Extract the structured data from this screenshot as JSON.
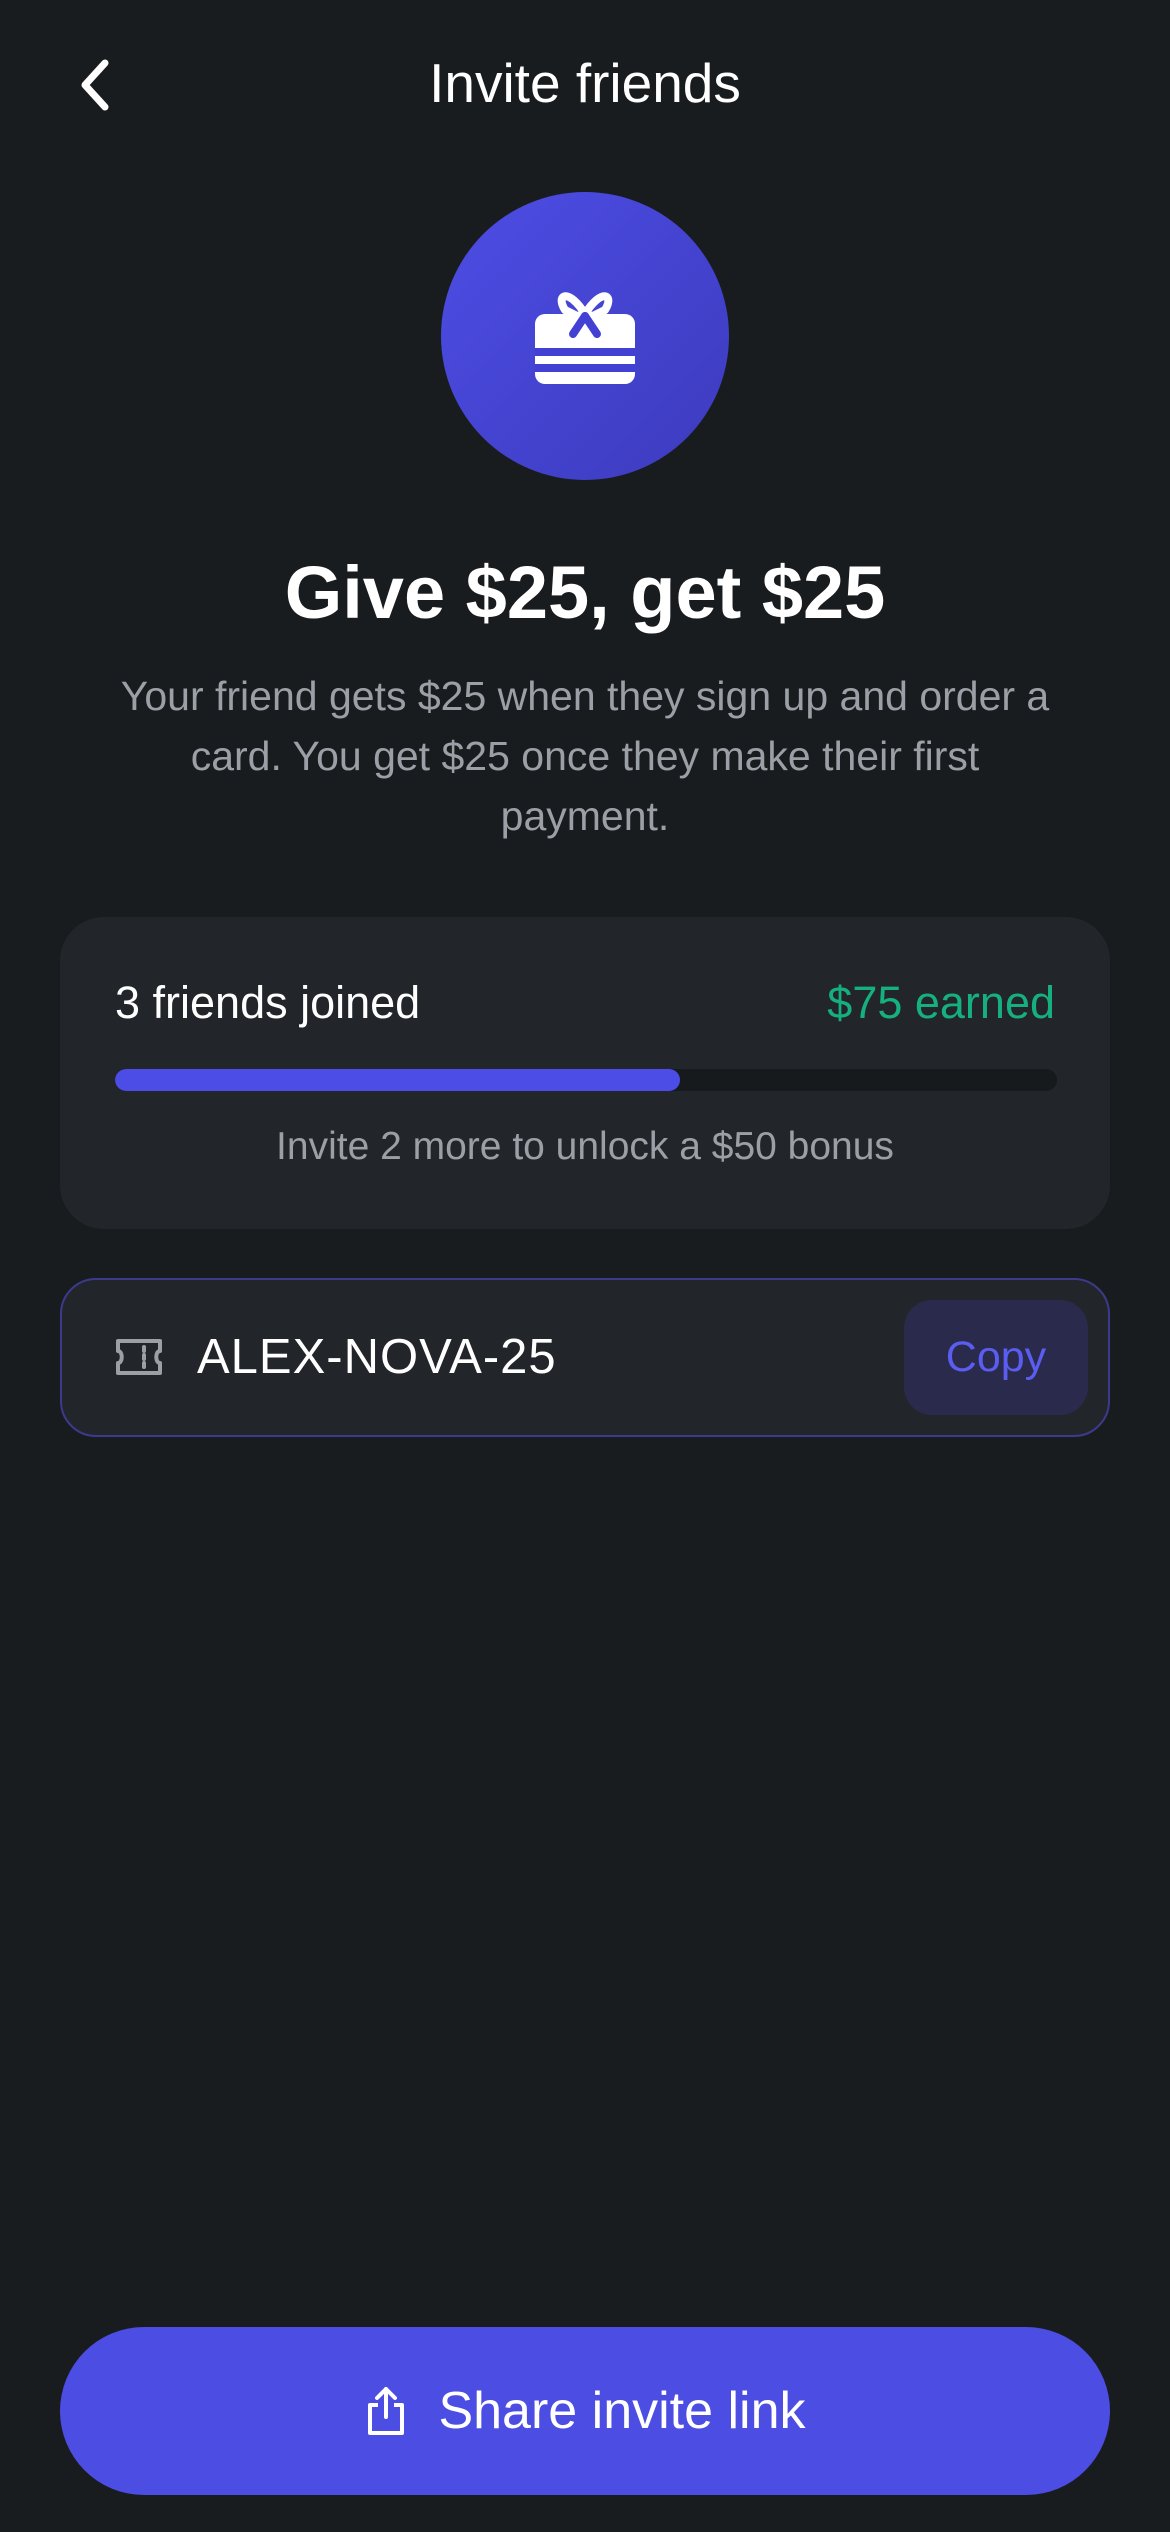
{
  "header": {
    "title": "Invite friends",
    "back_icon": "chevron-left-icon"
  },
  "hero": {
    "icon": "gift-card-icon",
    "headline": "Give $25, get $25",
    "description": "Your friend gets $25 when they sign up and order a card. You get $25 once they make their first payment."
  },
  "progress": {
    "joined_label": "3 friends joined",
    "earned_label": "$75 earned",
    "fill_fraction": 0.6,
    "bonus_label": "Invite 2 more to unlock a $50 bonus"
  },
  "referral": {
    "icon": "ticket-icon",
    "code": "ALEX-NOVA-25",
    "copy_label": "Copy"
  },
  "share": {
    "icon": "share-icon",
    "label": "Share invite link"
  },
  "colors": {
    "background": "#191c1f",
    "card": "#222529",
    "accent": "#4c4de3",
    "success": "#16b07e",
    "muted_text": "#9aa0a6"
  }
}
